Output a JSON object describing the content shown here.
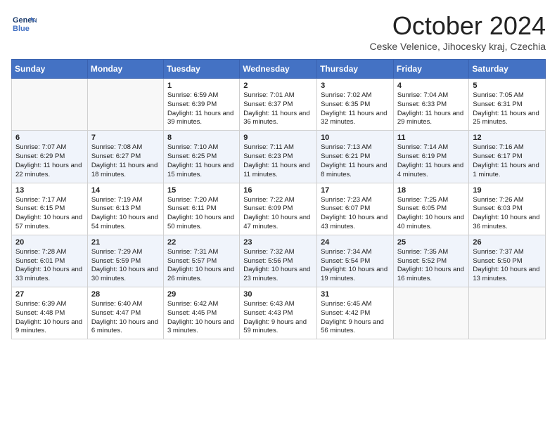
{
  "header": {
    "logo_line1": "General",
    "logo_line2": "Blue",
    "month": "October 2024",
    "location": "Ceske Velenice, Jihocesky kraj, Czechia"
  },
  "columns": [
    "Sunday",
    "Monday",
    "Tuesday",
    "Wednesday",
    "Thursday",
    "Friday",
    "Saturday"
  ],
  "weeks": [
    [
      {
        "day": "",
        "info": ""
      },
      {
        "day": "",
        "info": ""
      },
      {
        "day": "1",
        "info": "Sunrise: 6:59 AM\nSunset: 6:39 PM\nDaylight: 11 hours and 39 minutes."
      },
      {
        "day": "2",
        "info": "Sunrise: 7:01 AM\nSunset: 6:37 PM\nDaylight: 11 hours and 36 minutes."
      },
      {
        "day": "3",
        "info": "Sunrise: 7:02 AM\nSunset: 6:35 PM\nDaylight: 11 hours and 32 minutes."
      },
      {
        "day": "4",
        "info": "Sunrise: 7:04 AM\nSunset: 6:33 PM\nDaylight: 11 hours and 29 minutes."
      },
      {
        "day": "5",
        "info": "Sunrise: 7:05 AM\nSunset: 6:31 PM\nDaylight: 11 hours and 25 minutes."
      }
    ],
    [
      {
        "day": "6",
        "info": "Sunrise: 7:07 AM\nSunset: 6:29 PM\nDaylight: 11 hours and 22 minutes."
      },
      {
        "day": "7",
        "info": "Sunrise: 7:08 AM\nSunset: 6:27 PM\nDaylight: 11 hours and 18 minutes."
      },
      {
        "day": "8",
        "info": "Sunrise: 7:10 AM\nSunset: 6:25 PM\nDaylight: 11 hours and 15 minutes."
      },
      {
        "day": "9",
        "info": "Sunrise: 7:11 AM\nSunset: 6:23 PM\nDaylight: 11 hours and 11 minutes."
      },
      {
        "day": "10",
        "info": "Sunrise: 7:13 AM\nSunset: 6:21 PM\nDaylight: 11 hours and 8 minutes."
      },
      {
        "day": "11",
        "info": "Sunrise: 7:14 AM\nSunset: 6:19 PM\nDaylight: 11 hours and 4 minutes."
      },
      {
        "day": "12",
        "info": "Sunrise: 7:16 AM\nSunset: 6:17 PM\nDaylight: 11 hours and 1 minute."
      }
    ],
    [
      {
        "day": "13",
        "info": "Sunrise: 7:17 AM\nSunset: 6:15 PM\nDaylight: 10 hours and 57 minutes."
      },
      {
        "day": "14",
        "info": "Sunrise: 7:19 AM\nSunset: 6:13 PM\nDaylight: 10 hours and 54 minutes."
      },
      {
        "day": "15",
        "info": "Sunrise: 7:20 AM\nSunset: 6:11 PM\nDaylight: 10 hours and 50 minutes."
      },
      {
        "day": "16",
        "info": "Sunrise: 7:22 AM\nSunset: 6:09 PM\nDaylight: 10 hours and 47 minutes."
      },
      {
        "day": "17",
        "info": "Sunrise: 7:23 AM\nSunset: 6:07 PM\nDaylight: 10 hours and 43 minutes."
      },
      {
        "day": "18",
        "info": "Sunrise: 7:25 AM\nSunset: 6:05 PM\nDaylight: 10 hours and 40 minutes."
      },
      {
        "day": "19",
        "info": "Sunrise: 7:26 AM\nSunset: 6:03 PM\nDaylight: 10 hours and 36 minutes."
      }
    ],
    [
      {
        "day": "20",
        "info": "Sunrise: 7:28 AM\nSunset: 6:01 PM\nDaylight: 10 hours and 33 minutes."
      },
      {
        "day": "21",
        "info": "Sunrise: 7:29 AM\nSunset: 5:59 PM\nDaylight: 10 hours and 30 minutes."
      },
      {
        "day": "22",
        "info": "Sunrise: 7:31 AM\nSunset: 5:57 PM\nDaylight: 10 hours and 26 minutes."
      },
      {
        "day": "23",
        "info": "Sunrise: 7:32 AM\nSunset: 5:56 PM\nDaylight: 10 hours and 23 minutes."
      },
      {
        "day": "24",
        "info": "Sunrise: 7:34 AM\nSunset: 5:54 PM\nDaylight: 10 hours and 19 minutes."
      },
      {
        "day": "25",
        "info": "Sunrise: 7:35 AM\nSunset: 5:52 PM\nDaylight: 10 hours and 16 minutes."
      },
      {
        "day": "26",
        "info": "Sunrise: 7:37 AM\nSunset: 5:50 PM\nDaylight: 10 hours and 13 minutes."
      }
    ],
    [
      {
        "day": "27",
        "info": "Sunrise: 6:39 AM\nSunset: 4:48 PM\nDaylight: 10 hours and 9 minutes."
      },
      {
        "day": "28",
        "info": "Sunrise: 6:40 AM\nSunset: 4:47 PM\nDaylight: 10 hours and 6 minutes."
      },
      {
        "day": "29",
        "info": "Sunrise: 6:42 AM\nSunset: 4:45 PM\nDaylight: 10 hours and 3 minutes."
      },
      {
        "day": "30",
        "info": "Sunrise: 6:43 AM\nSunset: 4:43 PM\nDaylight: 9 hours and 59 minutes."
      },
      {
        "day": "31",
        "info": "Sunrise: 6:45 AM\nSunset: 4:42 PM\nDaylight: 9 hours and 56 minutes."
      },
      {
        "day": "",
        "info": ""
      },
      {
        "day": "",
        "info": ""
      }
    ]
  ]
}
